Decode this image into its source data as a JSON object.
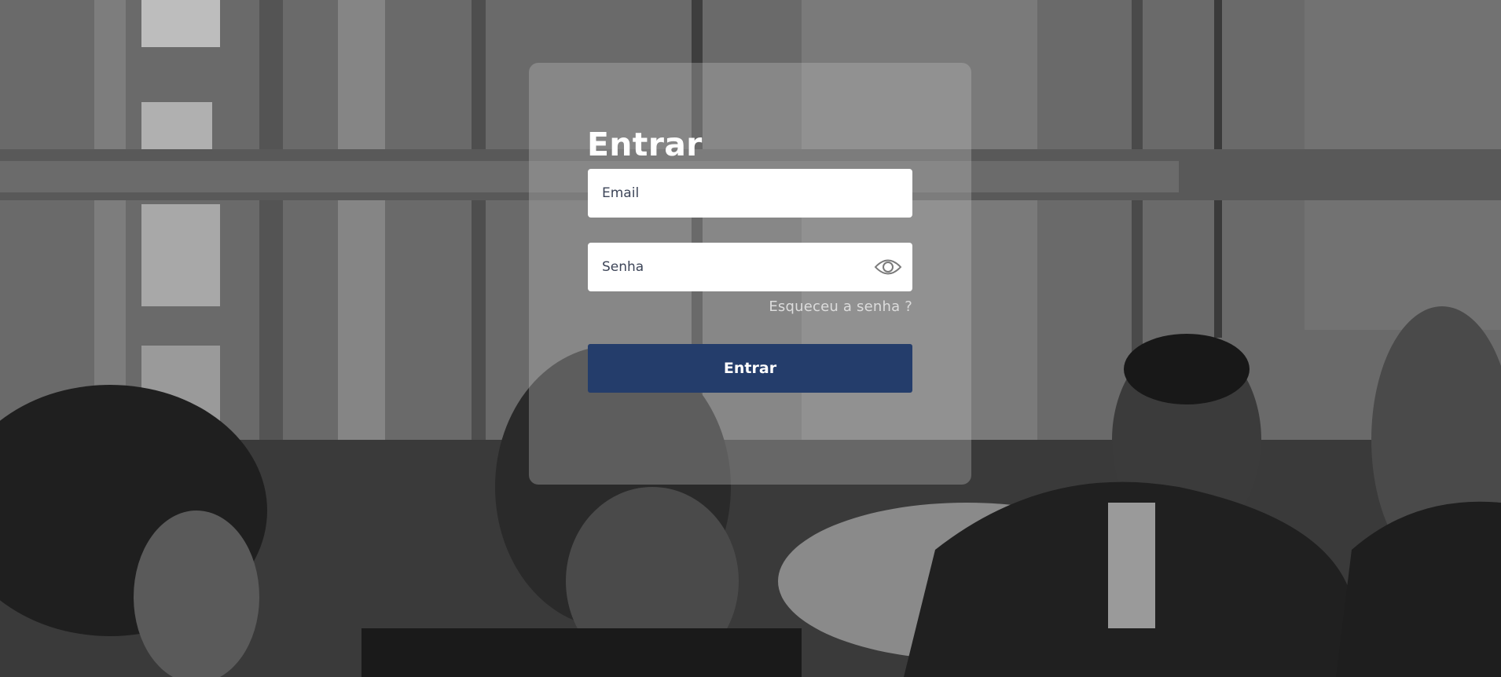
{
  "login": {
    "title": "Entrar",
    "email_placeholder": "Email",
    "password_placeholder": "Senha",
    "forgot_password_link": "Esqueceu a senha ?",
    "submit_label": "Entrar",
    "show_password_icon": "eye-icon"
  },
  "colors": {
    "submit_button": "#243d6b",
    "title_text": "#ffffff",
    "input_background": "#ffffff",
    "card_overlay": "rgba(190,190,190,0.35)"
  },
  "background": {
    "description_icon": "background-photo"
  }
}
